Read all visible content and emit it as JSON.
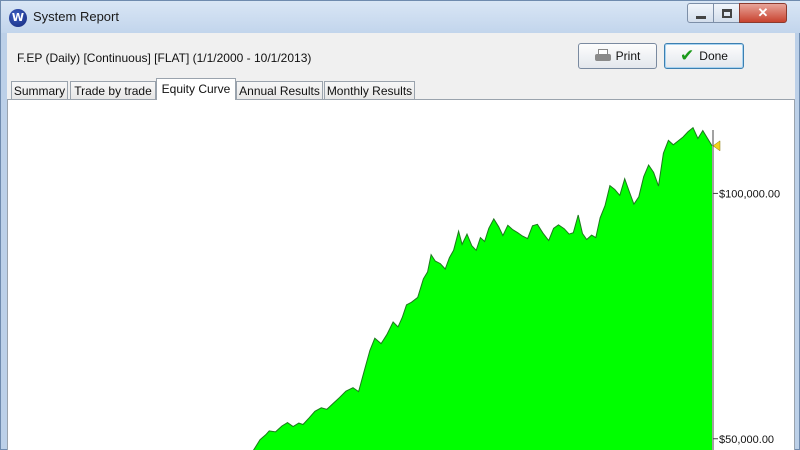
{
  "window": {
    "title": "System Report",
    "app_icon_letter": "W"
  },
  "report": {
    "label": "F.EP (Daily) [Continuous] [FLAT]  (1/1/2000 - 10/1/2013)"
  },
  "toolbar": {
    "print_label": "Print",
    "done_label": "Done"
  },
  "tabs": [
    {
      "label": "Summary",
      "active": false
    },
    {
      "label": "Trade by trade",
      "active": false
    },
    {
      "label": "Equity Curve",
      "active": true
    },
    {
      "label": "Annual Results",
      "active": false
    },
    {
      "label": "Monthly Results",
      "active": false
    }
  ],
  "colors": {
    "equity_fill": "#00ff00",
    "equity_line": "#1c7a1c",
    "marker": "#f2d21b"
  },
  "chart_data": {
    "type": "area",
    "ytick_labels": [
      "$100,000.00",
      "$50,000.00"
    ],
    "yticks": [
      100000,
      50000
    ],
    "ylim": [
      47300,
      117000
    ],
    "xlim": [
      0,
      1
    ],
    "x": [
      0.0,
      0.347,
      0.351,
      0.358,
      0.366,
      0.371,
      0.38,
      0.389,
      0.397,
      0.405,
      0.413,
      0.419,
      0.428,
      0.436,
      0.445,
      0.453,
      0.462,
      0.471,
      0.48,
      0.49,
      0.498,
      0.506,
      0.514,
      0.521,
      0.53,
      0.538,
      0.547,
      0.554,
      0.56,
      0.566,
      0.573,
      0.582,
      0.59,
      0.596,
      0.601,
      0.607,
      0.614,
      0.621,
      0.627,
      0.633,
      0.64,
      0.645,
      0.652,
      0.659,
      0.665,
      0.671,
      0.677,
      0.683,
      0.69,
      0.697,
      0.703,
      0.71,
      0.717,
      0.724,
      0.731,
      0.738,
      0.745,
      0.752,
      0.76,
      0.768,
      0.775,
      0.782,
      0.79,
      0.797,
      0.803,
      0.81,
      0.816,
      0.822,
      0.829,
      0.835,
      0.841,
      0.848,
      0.855,
      0.862,
      0.869,
      0.876,
      0.882,
      0.889,
      0.896,
      0.903,
      0.91,
      0.917,
      0.924,
      0.931,
      0.938,
      0.945,
      0.952,
      0.959,
      0.966,
      0.973,
      0.98,
      0.987,
      1.0
    ],
    "values": [
      47300,
      47300,
      48200,
      49800,
      50800,
      51600,
      51400,
      52600,
      53300,
      52500,
      53200,
      52900,
      54300,
      55600,
      56300,
      56000,
      57200,
      58400,
      59700,
      60400,
      59600,
      63800,
      68000,
      70500,
      69400,
      71200,
      73800,
      72800,
      74700,
      77300,
      77800,
      78800,
      82600,
      84000,
      87500,
      86200,
      85700,
      84600,
      86900,
      88400,
      92300,
      89600,
      91700,
      89300,
      88400,
      91000,
      90200,
      92900,
      94800,
      93200,
      91400,
      93500,
      92600,
      92000,
      91300,
      90800,
      93400,
      93700,
      91900,
      90400,
      92900,
      93600,
      92800,
      91700,
      92000,
      95600,
      91800,
      90600,
      91500,
      91000,
      95000,
      97500,
      101600,
      100800,
      99600,
      103000,
      100600,
      97800,
      99300,
      103400,
      105800,
      104300,
      101500,
      108200,
      110800,
      109900,
      110700,
      111500,
      112600,
      113400,
      111200,
      112800,
      109700
    ]
  }
}
